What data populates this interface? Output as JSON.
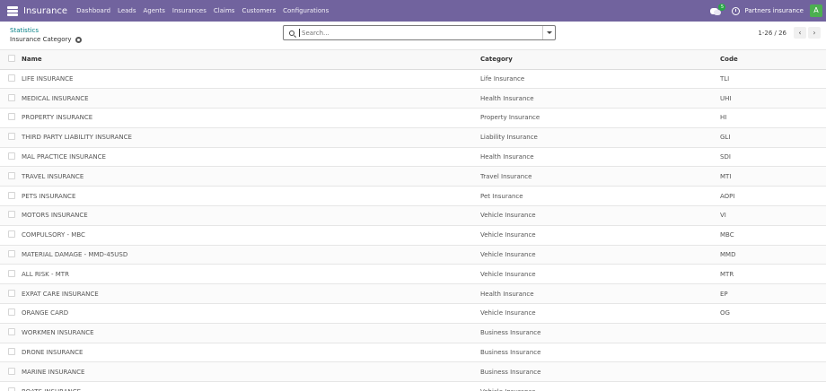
{
  "navbar": {
    "app_name": "Insurance",
    "menu": [
      "Dashboard",
      "Leads",
      "Agents",
      "Insurances",
      "Claims",
      "Customers",
      "Configurations"
    ],
    "chat_badge": "5",
    "company": "Partners insurance",
    "avatar": "A"
  },
  "control": {
    "breadcrumb": "Statistics",
    "title": "Insurance Category",
    "search_placeholder": "Search...",
    "pager": "1-26 / 26",
    "prev": "‹",
    "next": "›"
  },
  "table": {
    "headers": {
      "name": "Name",
      "category": "Category",
      "code": "Code"
    },
    "rows": [
      {
        "name": "LIFE INSURANCE",
        "category": "Life Insurance",
        "code": "TLI"
      },
      {
        "name": "MEDICAL INSURANCE",
        "category": "Health Insurance",
        "code": "UHI"
      },
      {
        "name": "PROPERTY INSURANCE",
        "category": "Property Insurance",
        "code": "HI"
      },
      {
        "name": "THIRD PARTY LIABILITY INSURANCE",
        "category": "Liability Insurance",
        "code": "GLI"
      },
      {
        "name": "MAL PRACTICE INSURANCE",
        "category": "Health Insurance",
        "code": "SDI"
      },
      {
        "name": "TRAVEL INSURANCE",
        "category": "Travel Insurance",
        "code": "MTI"
      },
      {
        "name": "PETS INSURANCE",
        "category": "Pet Insurance",
        "code": "AOPI"
      },
      {
        "name": "MOTORS INSURANCE",
        "category": "Vehicle Insurance",
        "code": "VI"
      },
      {
        "name": "COMPULSORY - MBC",
        "category": "Vehicle Insurance",
        "code": "MBC"
      },
      {
        "name": "MATERIAL DAMAGE - MMD-45USD",
        "category": "Vehicle Insurance",
        "code": "MMD"
      },
      {
        "name": "ALL RISK - MTR",
        "category": "Vehicle Insurance",
        "code": "MTR"
      },
      {
        "name": "EXPAT CARE INSURANCE",
        "category": "Health Insurance",
        "code": "EP"
      },
      {
        "name": "ORANGE CARD",
        "category": "Vehicle Insurance",
        "code": "OG"
      },
      {
        "name": "WORKMEN INSURANCE",
        "category": "Business Insurance",
        "code": ""
      },
      {
        "name": "DRONE INSURANCE",
        "category": "Business Insurance",
        "code": ""
      },
      {
        "name": "MARINE INSURANCE",
        "category": "Business Insurance",
        "code": ""
      },
      {
        "name": "BOATS INSURANCE",
        "category": "Vehicle Insurance",
        "code": ""
      }
    ]
  }
}
